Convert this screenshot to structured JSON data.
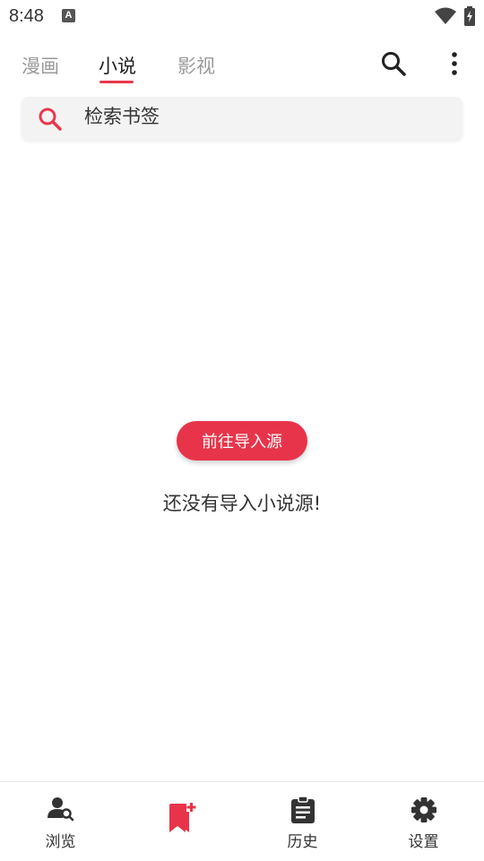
{
  "status_bar": {
    "time": "8:48",
    "notification_icon": "A",
    "icons": [
      "wifi-icon",
      "battery-icon"
    ]
  },
  "tabs": [
    {
      "label": "漫画",
      "active": false
    },
    {
      "label": "小说",
      "active": true
    },
    {
      "label": "影视",
      "active": false
    }
  ],
  "header_actions": [
    "search-icon",
    "more-vert-icon"
  ],
  "search": {
    "placeholder": "检索书签",
    "icon": "search-icon"
  },
  "empty_state": {
    "button_label": "前往导入源",
    "message": "还没有导入小说源!"
  },
  "bottom_nav": [
    {
      "label": "浏览",
      "icon": "person-search-icon"
    },
    {
      "label": "",
      "icon": "bookmark-add-icon",
      "active": true
    },
    {
      "label": "历史",
      "icon": "clipboard-icon"
    },
    {
      "label": "设置",
      "icon": "gear-icon"
    }
  ],
  "colors": {
    "accent": "#e8344a",
    "text": "#222222",
    "inactive": "#9a9a9a",
    "search_bg": "#f3f3f3"
  }
}
